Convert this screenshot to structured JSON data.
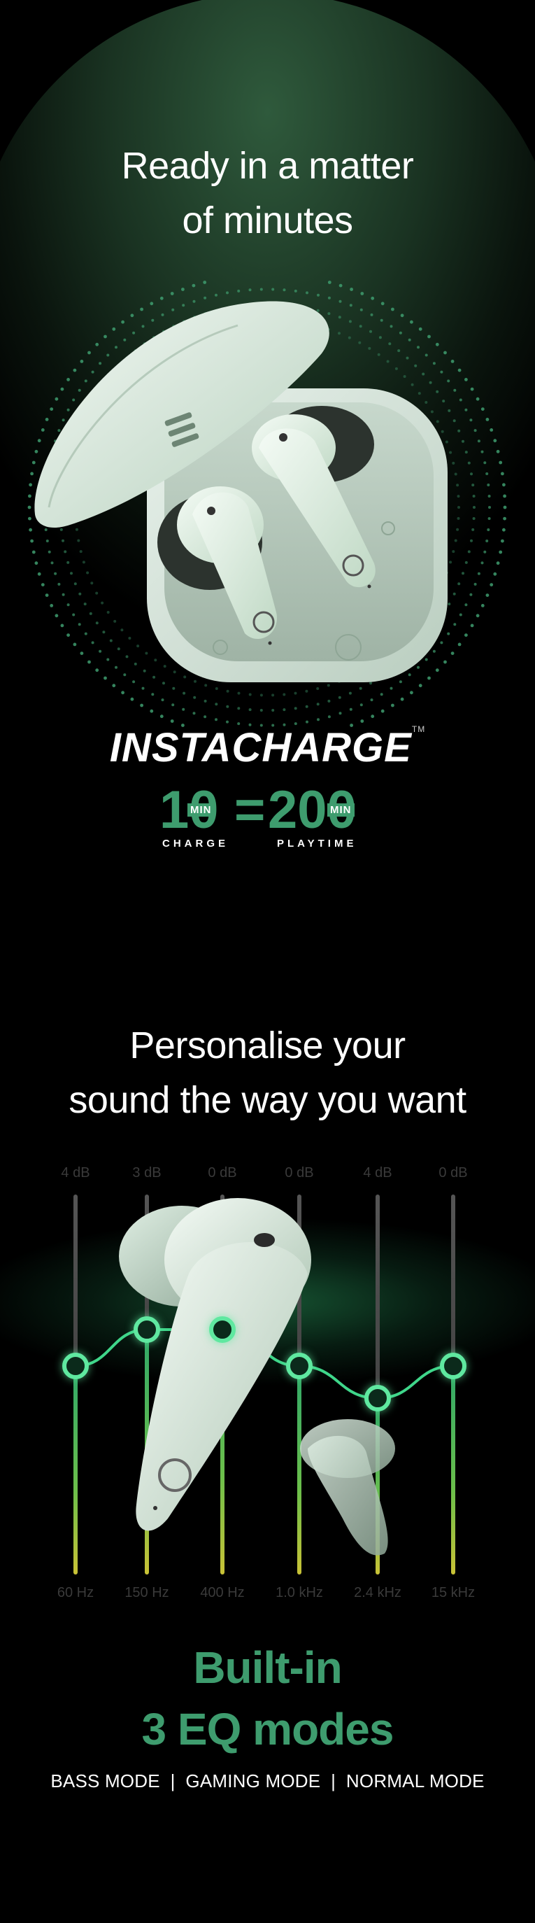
{
  "section1": {
    "title_line1": "Ready in a matter",
    "title_line2": "of minutes",
    "brand_logo": "INSTACHARGE",
    "trademark": "TM",
    "charge_value": "10",
    "charge_unit": "MIN",
    "equals": "=",
    "playtime_value": "200",
    "playtime_unit": "MIN",
    "charge_label": "CHARGE",
    "playtime_label": "PLAYTIME",
    "accent_color": "#3e9c6e"
  },
  "section2": {
    "title_line1": "Personalise your",
    "title_line2": "sound the way you want",
    "eq": {
      "gains": [
        "4 dB",
        "3 dB",
        "0 dB",
        "0 dB",
        "4 dB",
        "0 dB"
      ],
      "frequencies": [
        "60 Hz",
        "150 Hz",
        "400 Hz",
        "1.0 kHz",
        "2.4 kHz",
        "15 kHz"
      ],
      "knob_color": "#5fe8a0"
    },
    "headline_line1": "Built-in",
    "headline_line2": "3 EQ modes",
    "modes_text": "BASS MODE  |  GAMING MODE  |  NORMAL MODE"
  }
}
